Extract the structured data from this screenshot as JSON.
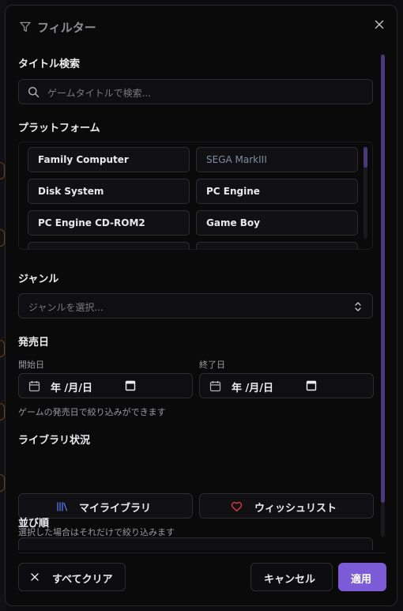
{
  "header": {
    "title": "フィルター",
    "icon": "funnel-icon",
    "close_icon": "close-icon"
  },
  "search": {
    "label": "タイトル検索",
    "placeholder": "ゲームタイトルで検索..."
  },
  "platform": {
    "label": "プラットフォーム",
    "items": [
      {
        "label": "Family Computer",
        "muted": false
      },
      {
        "label": "SEGA MarkIII",
        "muted": true
      },
      {
        "label": "Disk System",
        "muted": false
      },
      {
        "label": "PC Engine",
        "muted": false
      },
      {
        "label": "PC Engine CD-ROM2",
        "muted": false
      },
      {
        "label": "Game Boy",
        "muted": false
      }
    ]
  },
  "genre": {
    "label": "ジャンル",
    "placeholder": "ジャンルを選択..."
  },
  "release": {
    "label": "発売日",
    "start_label": "開始日",
    "end_label": "終了日",
    "start_value": "年 /月/日",
    "end_value": "年 /月/日",
    "hint": "ゲームの発売日で絞り込みができます"
  },
  "library": {
    "label": "ライブラリ状況",
    "my_library": "マイライブラリ",
    "wishlist": "ウィッシュリスト",
    "hint": "選択した場合はそれだけで絞り込みます"
  },
  "sort": {
    "label": "並び順"
  },
  "footer": {
    "clear_all": "すべてクリア",
    "cancel": "キャンセル",
    "apply": "適用"
  },
  "colors": {
    "accent": "#7b5bd6",
    "wishlist_heart": "#e0364b",
    "library_icon": "#4b6fe0"
  }
}
